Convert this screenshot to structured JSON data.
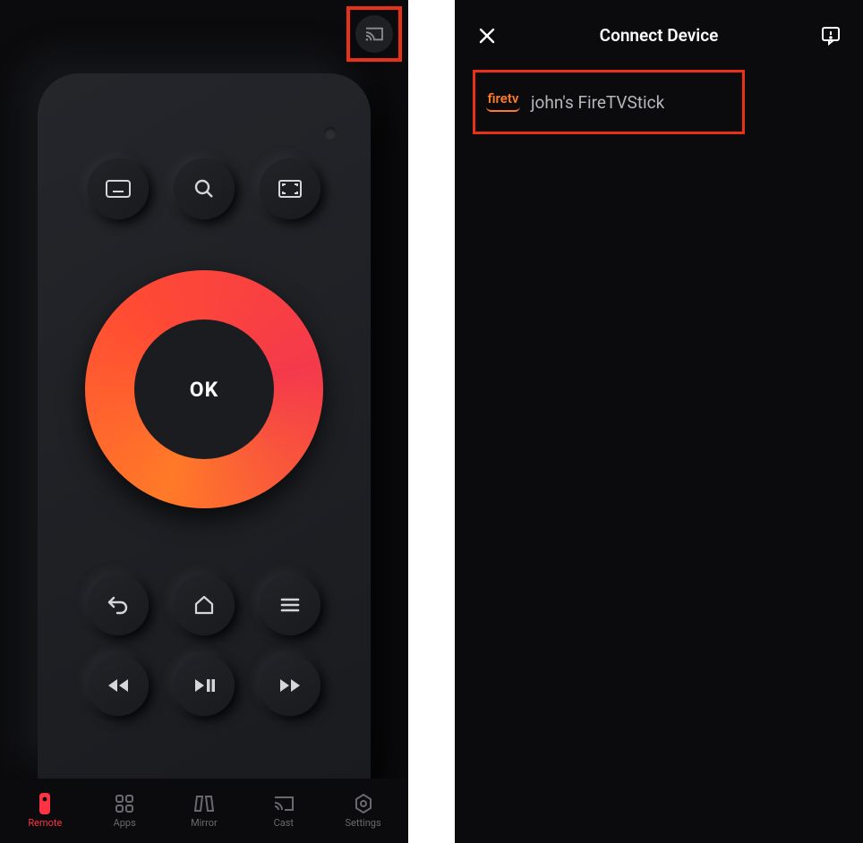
{
  "left": {
    "dpad_label": "OK",
    "nav": [
      {
        "label": "Remote",
        "active": true
      },
      {
        "label": "Apps",
        "active": false
      },
      {
        "label": "Mirror",
        "active": false
      },
      {
        "label": "Cast",
        "active": false
      },
      {
        "label": "Settings",
        "active": false
      }
    ]
  },
  "right": {
    "title": "Connect Device",
    "device": {
      "brand": "firetv",
      "name": "john's FireTVStick"
    }
  },
  "highlights": {
    "cast_icon": true,
    "device_row": true
  },
  "colors": {
    "highlight": "#e9311a",
    "accent_gradient_from": "#ff7a28",
    "accent_gradient_to": "#f43a4b",
    "nav_active": "#ff3344"
  }
}
